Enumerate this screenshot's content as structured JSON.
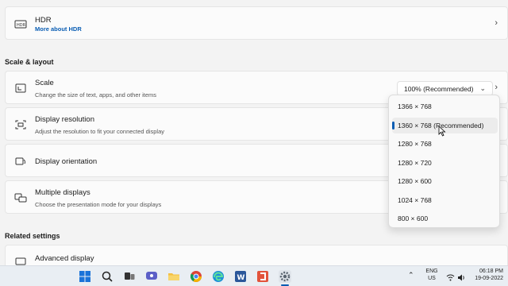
{
  "hdr": {
    "title": "HDR",
    "link": "More about HDR",
    "icon": "hdr-icon"
  },
  "sections": {
    "scale_layout": "Scale & layout",
    "related": "Related settings"
  },
  "scale": {
    "title": "Scale",
    "subtitle": "Change the size of text, apps, and other items",
    "value": "100% (Recommended)",
    "icon": "scale-icon"
  },
  "resolution": {
    "title": "Display resolution",
    "subtitle": "Adjust the resolution to fit your connected display",
    "icon": "resolution-icon",
    "options": [
      "1366 × 768",
      "1360 × 768 (Recommended)",
      "1280 × 768",
      "1280 × 720",
      "1280 × 600",
      "1024 × 768",
      "800 × 600"
    ],
    "selected_index": 1
  },
  "orientation": {
    "title": "Display orientation",
    "icon": "orientation-icon"
  },
  "multiple": {
    "title": "Multiple displays",
    "subtitle": "Choose the presentation mode for your displays",
    "icon": "multiple-displays-icon"
  },
  "advanced": {
    "title": "Advanced display"
  },
  "taskbar": {
    "apps": [
      "start-icon",
      "search-icon",
      "task-view-icon",
      "chat-icon",
      "file-explorer-icon",
      "chrome-icon",
      "edge-icon",
      "word-icon",
      "app-icon",
      "settings-icon"
    ],
    "lang_line1": "ENG",
    "lang_line2": "US",
    "time": "06:18 PM",
    "date": "19-09-2022"
  },
  "colors": {
    "accent": "#0a5db3",
    "background": "#f3f3f3",
    "card": "#fbfbfb"
  }
}
